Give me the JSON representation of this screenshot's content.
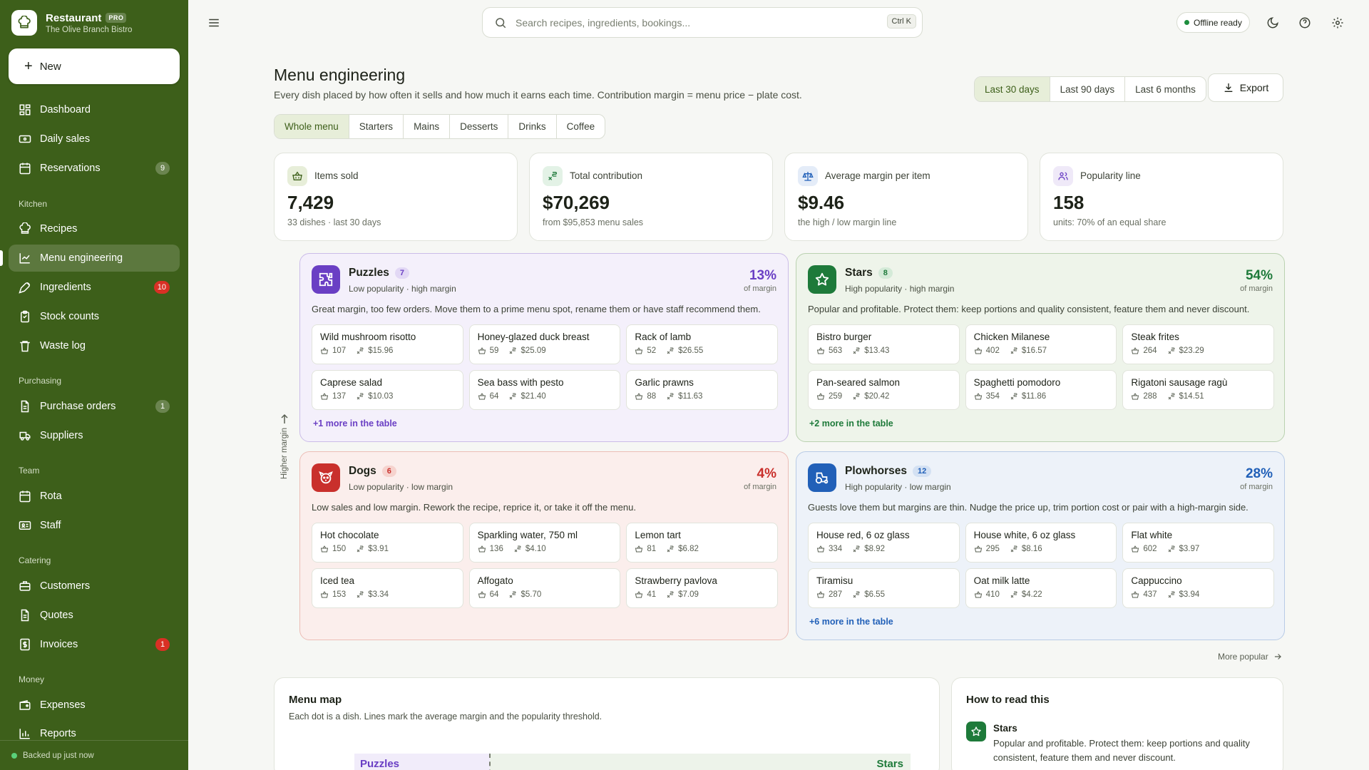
{
  "app": {
    "name": "Restaurant",
    "tier": "PRO",
    "subtitle": "The Olive Branch Bistro",
    "new_label": "New"
  },
  "nav": {
    "dashboard": "Dashboard",
    "daily_sales": "Daily sales",
    "reservations": "Reservations",
    "reservations_badge": "9",
    "kitchen": "Kitchen",
    "recipes": "Recipes",
    "menu_engineering": "Menu engineering",
    "ingredients": "Ingredients",
    "ingredients_badge": "10",
    "stock_counts": "Stock counts",
    "waste_log": "Waste log",
    "purchasing": "Purchasing",
    "purchase_orders": "Purchase orders",
    "purchase_orders_badge": "1",
    "suppliers": "Suppliers",
    "team": "Team",
    "rota": "Rota",
    "staff": "Staff",
    "catering": "Catering",
    "customers": "Customers",
    "quotes": "Quotes",
    "invoices": "Invoices",
    "invoices_badge": "1",
    "money": "Money",
    "expenses": "Expenses",
    "reports": "Reports"
  },
  "sync_status": "Backed up just now",
  "topbar": {
    "search_placeholder": "Search recipes, ingredients, bookings...",
    "shortcut": "Ctrl K",
    "offline": "Offline ready"
  },
  "page": {
    "title": "Menu engineering",
    "subtitle": "Every dish placed by how often it sells and how much it earns each time. Contribution margin = menu price − plate cost.",
    "ranges": [
      "Last 30 days",
      "Last 90 days",
      "Last 6 months"
    ],
    "export": "Export",
    "tabs": [
      "Whole menu",
      "Starters",
      "Mains",
      "Desserts",
      "Drinks",
      "Coffee"
    ]
  },
  "stats": [
    {
      "label": "Items sold",
      "value": "7,429",
      "note": "33 dishes · last 30 days"
    },
    {
      "label": "Total contribution",
      "value": "$70,269",
      "note": "from $95,853 menu sales"
    },
    {
      "label": "Average margin per item",
      "value": "$9.46",
      "note": "the high / low margin line"
    },
    {
      "label": "Popularity line",
      "value": "158",
      "note": "units: 70% of an equal share"
    }
  ],
  "axis_label": "Higher margin",
  "quadrants": {
    "puzzles": {
      "name": "Puzzles",
      "count": "7",
      "desc": "Low popularity · high margin",
      "pct": "13%",
      "pct_label": "of margin",
      "text": "Great margin, too few orders. Move them to a prime menu spot, rename them or have staff recommend them.",
      "dishes": [
        {
          "name": "Wild mushroom risotto",
          "sold": "107",
          "margin": "$15.96"
        },
        {
          "name": "Honey-glazed duck breast",
          "sold": "59",
          "margin": "$25.09"
        },
        {
          "name": "Rack of lamb",
          "sold": "52",
          "margin": "$26.55"
        },
        {
          "name": "Caprese salad",
          "sold": "137",
          "margin": "$10.03"
        },
        {
          "name": "Sea bass with pesto",
          "sold": "64",
          "margin": "$21.40"
        },
        {
          "name": "Garlic prawns",
          "sold": "88",
          "margin": "$11.63"
        }
      ],
      "more": "+1 more in the table"
    },
    "stars": {
      "name": "Stars",
      "count": "8",
      "desc": "High popularity · high margin",
      "pct": "54%",
      "pct_label": "of margin",
      "text": "Popular and profitable. Protect them: keep portions and quality consistent, feature them and never discount.",
      "dishes": [
        {
          "name": "Bistro burger",
          "sold": "563",
          "margin": "$13.43"
        },
        {
          "name": "Chicken Milanese",
          "sold": "402",
          "margin": "$16.57"
        },
        {
          "name": "Steak frites",
          "sold": "264",
          "margin": "$23.29"
        },
        {
          "name": "Pan-seared salmon",
          "sold": "259",
          "margin": "$20.42"
        },
        {
          "name": "Spaghetti pomodoro",
          "sold": "354",
          "margin": "$11.86"
        },
        {
          "name": "Rigatoni sausage ragù",
          "sold": "288",
          "margin": "$14.51"
        }
      ],
      "more": "+2 more in the table"
    },
    "dogs": {
      "name": "Dogs",
      "count": "6",
      "desc": "Low popularity · low margin",
      "pct": "4%",
      "pct_label": "of margin",
      "text": "Low sales and low margin. Rework the recipe, reprice it, or take it off the menu.",
      "dishes": [
        {
          "name": "Hot chocolate",
          "sold": "150",
          "margin": "$3.91"
        },
        {
          "name": "Sparkling water, 750 ml",
          "sold": "136",
          "margin": "$4.10"
        },
        {
          "name": "Lemon tart",
          "sold": "81",
          "margin": "$6.82"
        },
        {
          "name": "Iced tea",
          "sold": "153",
          "margin": "$3.34"
        },
        {
          "name": "Affogato",
          "sold": "64",
          "margin": "$5.70"
        },
        {
          "name": "Strawberry pavlova",
          "sold": "41",
          "margin": "$7.09"
        }
      ],
      "more": ""
    },
    "plowhorses": {
      "name": "Plowhorses",
      "count": "12",
      "desc": "High popularity · low margin",
      "pct": "28%",
      "pct_label": "of margin",
      "text": "Guests love them but margins are thin. Nudge the price up, trim portion cost or pair with a high-margin side.",
      "dishes": [
        {
          "name": "House red, 6 oz glass",
          "sold": "334",
          "margin": "$8.92"
        },
        {
          "name": "House white, 6 oz glass",
          "sold": "295",
          "margin": "$8.16"
        },
        {
          "name": "Flat white",
          "sold": "602",
          "margin": "$3.97"
        },
        {
          "name": "Tiramisu",
          "sold": "287",
          "margin": "$6.55"
        },
        {
          "name": "Oat milk latte",
          "sold": "410",
          "margin": "$4.22"
        },
        {
          "name": "Cappuccino",
          "sold": "437",
          "margin": "$3.94"
        }
      ],
      "more": "+6 more in the table"
    }
  },
  "more_popular": "More popular",
  "menu_map": {
    "title": "Menu map",
    "subtitle": "Each dot is a dish. Lines mark the average margin and the popularity threshold.",
    "left_label": "Puzzles",
    "right_label": "Stars"
  },
  "how_to": {
    "title": "How to read this",
    "item_title": "Stars",
    "item_text_1": "Popular and profitable. Protect them: keep portions and quality",
    "item_text_2": "consistent, feature them and never discount."
  },
  "colors": {
    "sidebar": "#3d5f1a",
    "puzzles": "#6a3fc4",
    "stars": "#1e7a3a",
    "dogs": "#c9302c",
    "plowhorses": "#2160b8"
  }
}
